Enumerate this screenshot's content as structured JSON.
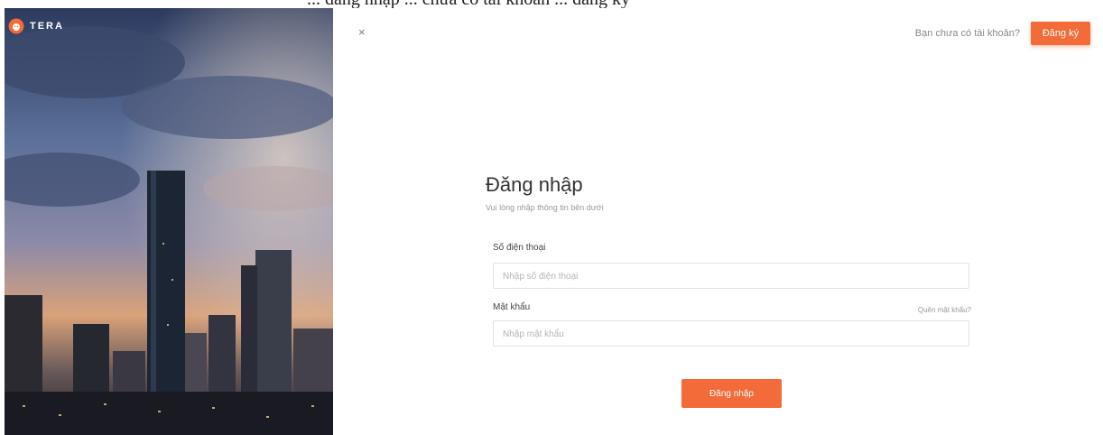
{
  "header": {
    "clipped_caption": "... đăng nhập ... chưa có tài khoản ... đăng ký",
    "brand_name": "TERA",
    "close_glyph": "×",
    "signup_prompt": "Bạn chưa có tài khoản?",
    "signup_button": "Đăng ký"
  },
  "login_form": {
    "title": "Đăng nhập",
    "subtitle": "Vui lòng nhập thông tin bên dưới",
    "phone": {
      "label": "Số điện thoại",
      "placeholder": "Nhập số điện thoại"
    },
    "password": {
      "label": "Mật khẩu",
      "placeholder": "Nhập mật khẩu",
      "forgot_link": "Quên mật khẩu?"
    },
    "submit_button": "Đăng nhập"
  },
  "colors": {
    "accent": "#f26b38",
    "text": "#333333",
    "muted": "#999999",
    "border": "#e2e2e2"
  },
  "icons": {
    "brand": "lion-logo-icon",
    "close": "close-icon"
  }
}
